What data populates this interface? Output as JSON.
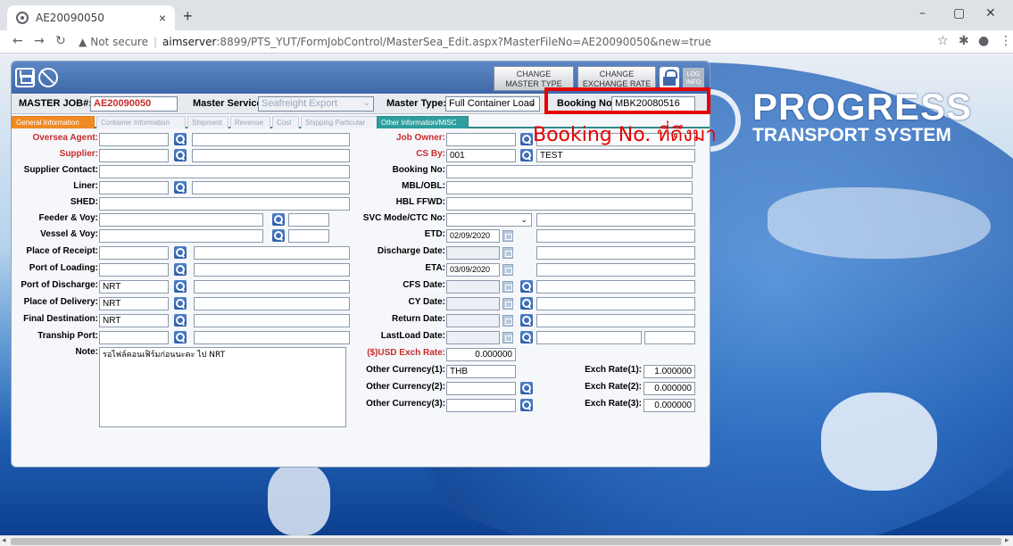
{
  "browser": {
    "tab_title": "AE20090050",
    "close_tab": "×",
    "new_tab": "+",
    "url_warning": "Not secure",
    "url_separator": "|",
    "url_host": "aimserver",
    "url_path": ":8899/PTS_YUT/FormJobControl/MasterSea_Edit.aspx?MasterFileNo=AE20090050&new=true",
    "win_min": "–",
    "win_max": "▢",
    "win_close": "✕"
  },
  "logo": {
    "title": "PROGRESS",
    "subtitle": "TRANSPORT SYSTEM"
  },
  "toolbar": {
    "change_master_type": [
      "CHANGE",
      "MASTER TYPE"
    ],
    "change_exchange_rate": [
      "CHANGE",
      "EXCHANGE RATE"
    ],
    "log_info": [
      "LOG",
      "INFO"
    ]
  },
  "master": {
    "job_label": "MASTER JOB#:",
    "job_value": "AE20090050",
    "service_label": "Master Service:",
    "service_value": "Seafreight Export",
    "type_label": "Master Type:",
    "type_value": "Full Container Load",
    "booking_label": "Booking No:",
    "booking_value": "MBK20080516"
  },
  "tabs": [
    "General Information",
    "Container Information",
    "Shipment",
    "Revenue",
    "Cost",
    "Shipping Particular",
    "Other Information/MISC"
  ],
  "left": {
    "oversea_agent": "Oversea Agent:",
    "supplier": "Supplier:",
    "supplier_contact": "Supplier Contact:",
    "liner": "Liner:",
    "shed": "SHED:",
    "feeder_voy": "Feeder & Voy:",
    "vessel_voy": "Vessel & Voy:",
    "place_receipt": "Place of Receipt:",
    "port_loading": "Port of Loading:",
    "port_discharge": "Port of Discharge:",
    "port_discharge_value": "NRT",
    "place_delivery": "Place of Delivery:",
    "place_delivery_value": "NRT",
    "final_destination": "Final Destination:",
    "final_destination_value": "NRT",
    "tranship_port": "Tranship Port:",
    "note": "Note:",
    "note_value": "รอไฟล์คอนเฟิร์มก่อนนะคะ ไป NRT"
  },
  "right": {
    "job_owner": "Job Owner:",
    "cs_by": "CS By:",
    "cs_by_code": "001",
    "cs_by_name": "TEST",
    "booking_no": "Booking No:",
    "mbl_obl": "MBL/OBL:",
    "hbl_ffwd": "HBL FFWD:",
    "svc_mode": "SVC Mode/CTC No:",
    "etd": "ETD:",
    "etd_value": "02/09/2020",
    "discharge_date": "Discharge Date:",
    "eta": "ETA:",
    "eta_value": "03/09/2020",
    "cfs_date": "CFS Date:",
    "cy_date": "CY Date:",
    "return_date": "Return Date:",
    "lastload_date": "LastLoad Date:",
    "usd_rate": "($)USD Exch Rate:",
    "usd_rate_value": "0.000000",
    "other_cur1": "Other Currency(1):",
    "other_cur1_value": "THB",
    "other_cur2": "Other Currency(2):",
    "other_cur3": "Other Currency(3):",
    "exch1": "Exch Rate(1):",
    "exch1_value": "1.000000",
    "exch2": "Exch Rate(2):",
    "exch2_value": "0.000000",
    "exch3": "Exch Rate(3):",
    "exch3_value": "0.000000"
  },
  "annotation": {
    "text": "Booking No. ที่ดึงมา",
    "color": "#e60000"
  },
  "colors": {
    "required_label": "#c92b2b",
    "active_tab": "#f08a24",
    "misc_tab": "#2e9e9e",
    "toolbar": "#3f68a8"
  }
}
